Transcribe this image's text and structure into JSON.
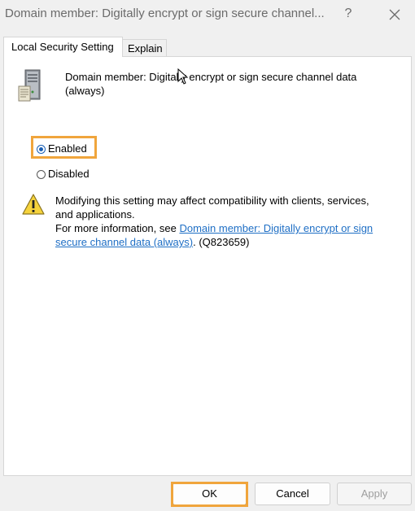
{
  "window": {
    "title": "Domain member: Digitally encrypt or sign secure channel...",
    "help_label": "?"
  },
  "tabs": [
    {
      "label": "Local Security Setting",
      "active": true
    },
    {
      "label": "Explain",
      "active": false
    }
  ],
  "policy": {
    "name": "Domain member: Digitally encrypt or sign secure channel data (always)"
  },
  "options": {
    "enabled_label": "Enabled",
    "disabled_label": "Disabled",
    "selected": "Enabled"
  },
  "warning": {
    "line1": "Modifying this setting may affect compatibility with clients, services, and applications.",
    "more_info_prefix": "For more information, see ",
    "link_text": "Domain member: Digitally encrypt or sign secure channel data (always)",
    "suffix": ". (Q823659)"
  },
  "buttons": {
    "ok": "OK",
    "cancel": "Cancel",
    "apply": "Apply"
  },
  "icons": {
    "policy": "server-computer-icon",
    "warning": "warning-triangle-icon",
    "close": "close-icon",
    "cursor": "mouse-pointer-icon"
  },
  "colors": {
    "highlight": "#f0a53c",
    "link": "#1f6fc5",
    "radio_selected": "#1a5fb4"
  }
}
